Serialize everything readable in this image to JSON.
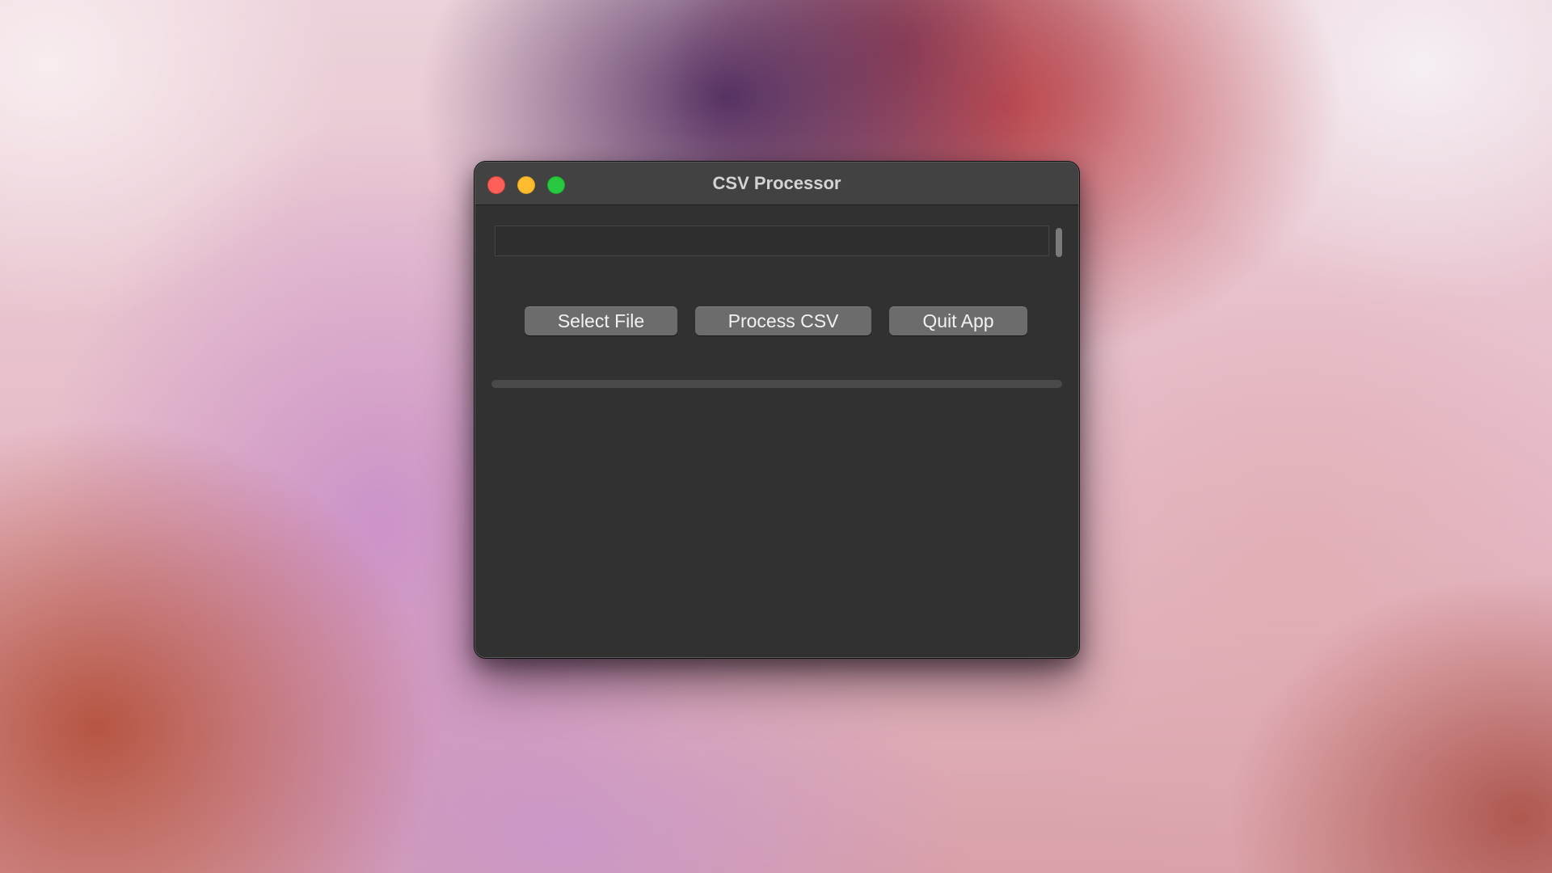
{
  "window": {
    "title": "CSV Processor",
    "traffic_lights": {
      "close_color": "#fe5f57",
      "minimize_color": "#febc2e",
      "maximize_color": "#28c840"
    }
  },
  "file_path": {
    "value": "",
    "placeholder": ""
  },
  "buttons": {
    "select_file": "Select File",
    "process_csv": "Process CSV",
    "quit_app": "Quit App"
  },
  "progress": {
    "value_percent": 0
  },
  "colors": {
    "window_bg": "#313131",
    "titlebar_bg": "#424242",
    "button_bg": "#6c6c6c",
    "progress_track": "#4a4a4a"
  }
}
